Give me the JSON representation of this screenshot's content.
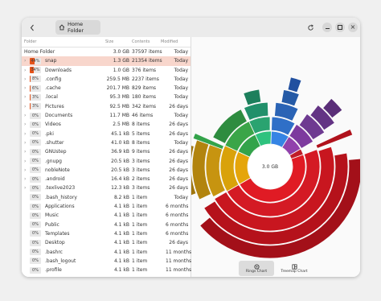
{
  "header": {
    "back_icon": "chevron-left-icon",
    "home_icon": "home-icon",
    "location": "Home Folder",
    "refresh_icon": "refresh-icon",
    "menu_icon": "hamburger-menu-icon",
    "minimize_icon": "minimize-icon",
    "maximize_icon": "maximize-icon",
    "close_icon": "close-icon"
  },
  "columns": {
    "folder": "Folder",
    "size": "Size",
    "contents": "Contents",
    "modified": "Modified"
  },
  "root": {
    "name": "Home Folder",
    "size": "3.0 GB",
    "contents": "37597 items",
    "modified": "Today"
  },
  "rows": [
    {
      "exp": "›",
      "pct": "44%",
      "fill": 0.44,
      "name": "snap",
      "size": "1.3 GB",
      "contents": "21354 items",
      "modified": "Today",
      "selected": true
    },
    {
      "exp": "›",
      "pct": "34%",
      "fill": 0.34,
      "name": "Downloads",
      "size": "1.0 GB",
      "contents": "376 items",
      "modified": "Today"
    },
    {
      "exp": "›",
      "pct": "8%",
      "fill": 0.08,
      "name": ".config",
      "size": "259.5 MB",
      "contents": "2237 items",
      "modified": "Today"
    },
    {
      "exp": "›",
      "pct": "6%",
      "fill": 0.06,
      "name": ".cache",
      "size": "201.7 MB",
      "contents": "829 items",
      "modified": "Today"
    },
    {
      "exp": "›",
      "pct": "3%",
      "fill": 0.03,
      "name": ".local",
      "size": "95.3 MB",
      "contents": "180 items",
      "modified": "Today"
    },
    {
      "exp": "›",
      "pct": "3%",
      "fill": 0.03,
      "name": "Pictures",
      "size": "92.5 MB",
      "contents": "342 items",
      "modified": "26 days"
    },
    {
      "exp": "›",
      "pct": "0%",
      "fill": 0,
      "name": "Documents",
      "size": "11.7 MB",
      "contents": "46 items",
      "modified": "Today"
    },
    {
      "exp": "›",
      "pct": "0%",
      "fill": 0,
      "name": "Videos",
      "size": "2.5 MB",
      "contents": "8 items",
      "modified": "26 days"
    },
    {
      "exp": "›",
      "pct": "0%",
      "fill": 0,
      "name": ".pki",
      "size": "45.1 kB",
      "contents": "5 items",
      "modified": "26 days"
    },
    {
      "exp": "›",
      "pct": "0%",
      "fill": 0,
      "name": ".shutter",
      "size": "41.0 kB",
      "contents": "8 items",
      "modified": "Today"
    },
    {
      "exp": "›",
      "pct": "0%",
      "fill": 0,
      "name": "GNUstep",
      "size": "36.9 kB",
      "contents": "9 items",
      "modified": "26 days"
    },
    {
      "exp": "›",
      "pct": "0%",
      "fill": 0,
      "name": ".gnupg",
      "size": "20.5 kB",
      "contents": "3 items",
      "modified": "26 days"
    },
    {
      "exp": "›",
      "pct": "0%",
      "fill": 0,
      "name": "nobleNote",
      "size": "20.5 kB",
      "contents": "3 items",
      "modified": "26 days"
    },
    {
      "exp": "›",
      "pct": "0%",
      "fill": 0,
      "name": ".android",
      "size": "16.4 kB",
      "contents": "2 items",
      "modified": "26 days"
    },
    {
      "exp": "›",
      "pct": "0%",
      "fill": 0,
      "name": ".texlive2023",
      "size": "12.3 kB",
      "contents": "3 items",
      "modified": "26 days"
    },
    {
      "exp": "",
      "pct": "0%",
      "fill": 0,
      "name": ".bash_history",
      "size": "8.2 kB",
      "contents": "1 item",
      "modified": "Today"
    },
    {
      "exp": "",
      "pct": "0%",
      "fill": 0,
      "name": "Applications",
      "size": "4.1 kB",
      "contents": "1 item",
      "modified": "6 months"
    },
    {
      "exp": "",
      "pct": "0%",
      "fill": 0,
      "name": "Music",
      "size": "4.1 kB",
      "contents": "1 item",
      "modified": "6 months"
    },
    {
      "exp": "",
      "pct": "0%",
      "fill": 0,
      "name": "Public",
      "size": "4.1 kB",
      "contents": "1 item",
      "modified": "6 months"
    },
    {
      "exp": "",
      "pct": "0%",
      "fill": 0,
      "name": "Templates",
      "size": "4.1 kB",
      "contents": "1 item",
      "modified": "6 months"
    },
    {
      "exp": "",
      "pct": "0%",
      "fill": 0,
      "name": "Desktop",
      "size": "4.1 kB",
      "contents": "1 item",
      "modified": "26 days"
    },
    {
      "exp": "",
      "pct": "0%",
      "fill": 0,
      "name": ".bashrc",
      "size": "4.1 kB",
      "contents": "1 item",
      "modified": "11 months"
    },
    {
      "exp": "",
      "pct": "0%",
      "fill": 0,
      "name": ".bash_logout",
      "size": "4.1 kB",
      "contents": "1 item",
      "modified": "11 months"
    },
    {
      "exp": "",
      "pct": "0%",
      "fill": 0,
      "name": ".profile",
      "size": "4.1 kB",
      "contents": "1 item",
      "modified": "11 months"
    }
  ],
  "chart": {
    "center_label": "3.0 GB"
  },
  "view_switcher": {
    "rings": "Rings Chart",
    "treemap": "Treemap Chart",
    "rings_icon": "rings-chart-icon",
    "treemap_icon": "treemap-chart-icon"
  },
  "colors": {
    "accent": "#e5531a",
    "selected_row": "#f8d6cc"
  }
}
